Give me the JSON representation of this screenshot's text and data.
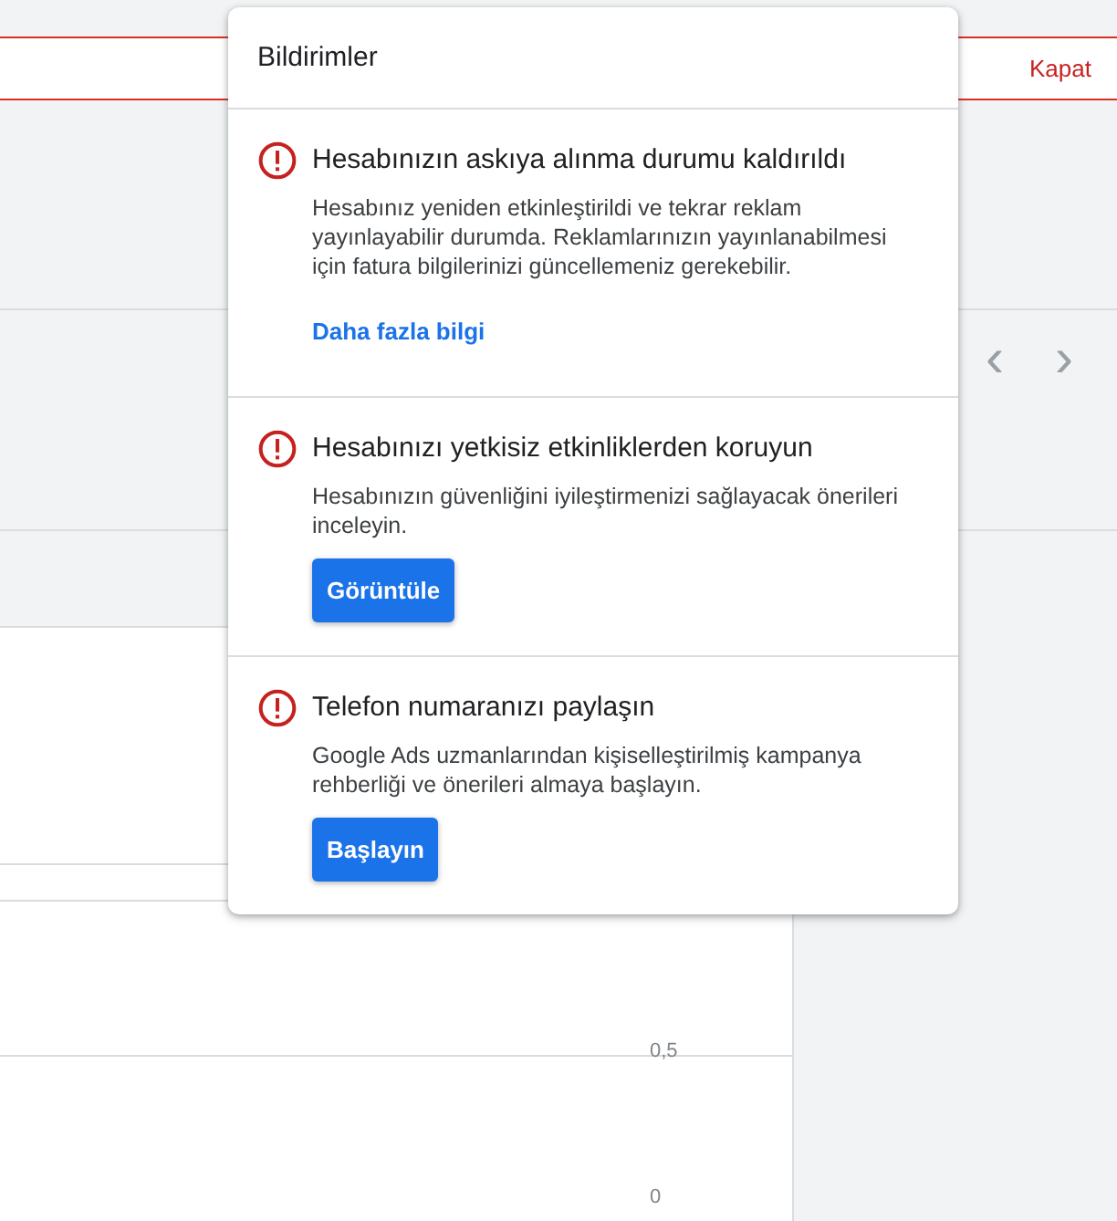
{
  "banner": {
    "close_label": "Kapat"
  },
  "pager": {
    "prev": "‹",
    "next": "›"
  },
  "chart_axis": {
    "labels": [
      "0,5",
      "0"
    ]
  },
  "notifications": {
    "title": "Bildirimler",
    "items": [
      {
        "kind": "link",
        "title": "Hesabınızın askıya alınma durumu kaldırıldı",
        "body": "Hesabınız yeniden etkinleştirildi ve tekrar reklam yayınlayabilir durumda. Reklamlarınızın yayınlanabilmesi için fatura bilgilerinizi güncellemeniz gerekebilir.",
        "action": "Daha fazla bilgi"
      },
      {
        "kind": "button",
        "title": "Hesabınızı yetkisiz etkinliklerden koruyun",
        "body": "Hesabınızın güvenliğini iyileştirmenizi sağlayacak önerileri inceleyin.",
        "action": "Görüntüle"
      },
      {
        "kind": "button",
        "title": "Telefon numaranızı paylaşın",
        "body": "Google Ads uzmanlarından kişiselleştirilmiş kampanya rehberliği ve önerileri almaya başlayın.",
        "action": "Başlayın"
      }
    ]
  }
}
